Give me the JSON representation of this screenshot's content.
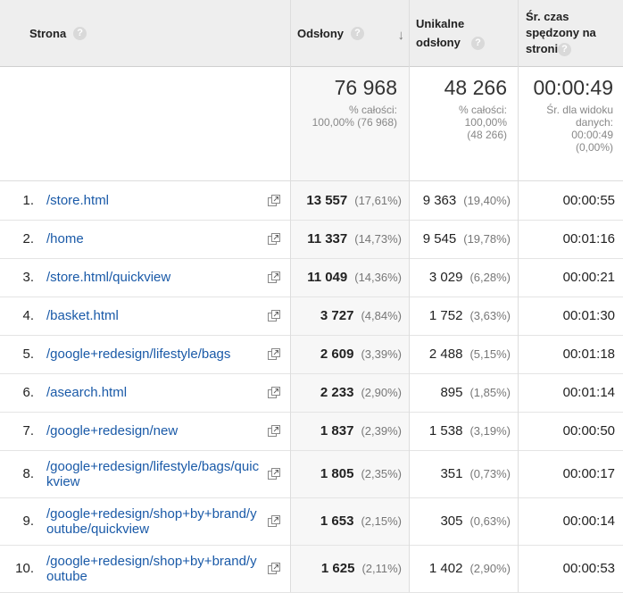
{
  "header": {
    "page": "Strona",
    "views": "Odsłony",
    "unique": "Unikalne odsłony",
    "avg_time": "Śr. czas spędzony na stronie"
  },
  "totals": {
    "views": "76 968",
    "views_sub1": "% całości:",
    "views_sub2": "100,00% (76 968)",
    "unique": "48 266",
    "unique_sub1": "% całości:",
    "unique_sub2": "100,00%",
    "unique_sub3": "(48 266)",
    "time": "00:00:49",
    "time_sub1": "Śr. dla widoku",
    "time_sub2": "danych:",
    "time_sub3": "00:00:49",
    "time_sub4": "(0,00%)"
  },
  "rows": [
    {
      "num": "1.",
      "page": "/store.html",
      "views": "13 557",
      "views_pct": "(17,61%)",
      "unique": "9 363",
      "unique_pct": "(19,40%)",
      "time": "00:00:55"
    },
    {
      "num": "2.",
      "page": "/home",
      "views": "11 337",
      "views_pct": "(14,73%)",
      "unique": "9 545",
      "unique_pct": "(19,78%)",
      "time": "00:01:16"
    },
    {
      "num": "3.",
      "page": "/store.html/quickview",
      "views": "11 049",
      "views_pct": "(14,36%)",
      "unique": "3 029",
      "unique_pct": "(6,28%)",
      "time": "00:00:21"
    },
    {
      "num": "4.",
      "page": "/basket.html",
      "views": "3 727",
      "views_pct": "(4,84%)",
      "unique": "1 752",
      "unique_pct": "(3,63%)",
      "time": "00:01:30"
    },
    {
      "num": "5.",
      "page": "/google+redesign/lifestyle/bags",
      "views": "2 609",
      "views_pct": "(3,39%)",
      "unique": "2 488",
      "unique_pct": "(5,15%)",
      "time": "00:01:18"
    },
    {
      "num": "6.",
      "page": "/asearch.html",
      "views": "2 233",
      "views_pct": "(2,90%)",
      "unique": "895",
      "unique_pct": "(1,85%)",
      "time": "00:01:14"
    },
    {
      "num": "7.",
      "page": "/google+redesign/new",
      "views": "1 837",
      "views_pct": "(2,39%)",
      "unique": "1 538",
      "unique_pct": "(3,19%)",
      "time": "00:00:50"
    },
    {
      "num": "8.",
      "page": "/google+redesign/lifestyle/bags/quickview",
      "views": "1 805",
      "views_pct": "(2,35%)",
      "unique": "351",
      "unique_pct": "(0,73%)",
      "time": "00:00:17"
    },
    {
      "num": "9.",
      "page": "/google+redesign/shop+by+brand/youtube/quickview",
      "views": "1 653",
      "views_pct": "(2,15%)",
      "unique": "305",
      "unique_pct": "(0,63%)",
      "time": "00:00:14"
    },
    {
      "num": "10.",
      "page": "/google+redesign/shop+by+brand/youtube",
      "views": "1 625",
      "views_pct": "(2,11%)",
      "unique": "1 402",
      "unique_pct": "(2,90%)",
      "time": "00:00:53"
    }
  ]
}
